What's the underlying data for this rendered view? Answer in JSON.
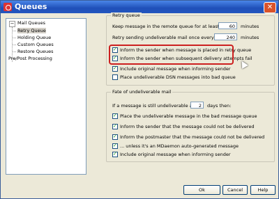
{
  "window": {
    "title": "Queues",
    "close_glyph": "✕"
  },
  "tree": {
    "root": "Mail Queues",
    "expander": "−",
    "children": [
      "Retry Queue",
      "Holding Queue",
      "Custom Queues",
      "Restore Queues"
    ],
    "selected": "Retry Queue",
    "other": "Pre/Post Processing"
  },
  "retry": {
    "legend": "Retry queue",
    "keep_label": "Keep message in the remote queue for at least",
    "keep_value": "60",
    "keep_unit": "minutes",
    "send_label": "Retry sending undeliverable mail once every",
    "send_value": "240",
    "send_unit": "minutes",
    "options": [
      {
        "label": "Inform the sender when message is placed in retry queue",
        "checked": true
      },
      {
        "label": "Inform the sender when subsequent delivery attempts fail",
        "checked": true
      },
      {
        "label": "Include original message when informing sender",
        "checked": true
      },
      {
        "label": "Place undeliverable DSN messages into bad queue",
        "checked": false
      }
    ]
  },
  "undeliverable": {
    "legend": "Fate of undeliverable mail",
    "after_label": "If a message is still undeliverable after",
    "after_value": "2",
    "after_unit": "days then:",
    "options": [
      {
        "label": "Place the undeliverable message in the bad message queue",
        "checked": true
      },
      {
        "label": "Inform the sender that the message could not be delivered",
        "checked": true
      },
      {
        "label": "Inform the postmaster that the message could not be delivered",
        "checked": true
      },
      {
        "label": "... unless it's an MDaemon auto-generated message",
        "checked": true
      },
      {
        "label": "Include original message when informing sender",
        "checked": true
      }
    ]
  },
  "buttons": {
    "ok": "Ok",
    "cancel": "Cancel",
    "help": "Help"
  }
}
